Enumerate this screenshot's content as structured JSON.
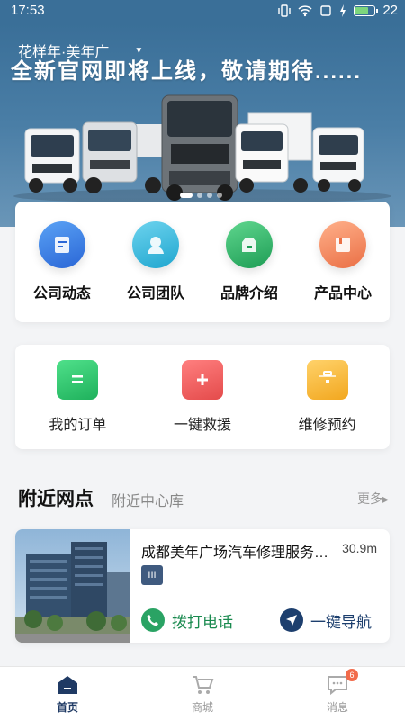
{
  "status": {
    "time": "17:53",
    "battery": "22",
    "battery_fraction": 0.6
  },
  "hero": {
    "location": "花样年·美年广",
    "slogan": "全新官网即将上线，敬请期待......",
    "slide_count": 4,
    "active_slide": 0
  },
  "shortcuts": [
    {
      "label": "公司动态",
      "icon": "news-icon",
      "color": "#3b7be0"
    },
    {
      "label": "公司团队",
      "icon": "team-icon",
      "color": "#2bb5d8"
    },
    {
      "label": "品牌介绍",
      "icon": "brand-icon",
      "color": "#27ae60"
    },
    {
      "label": "产品中心",
      "icon": "product-icon",
      "color": "#f08a5d"
    }
  ],
  "services": [
    {
      "label": "我的订单",
      "icon": "order-icon",
      "color": "#2ec46e"
    },
    {
      "label": "一键救援",
      "icon": "rescue-icon",
      "color": "#ee5a5a"
    },
    {
      "label": "维修预约",
      "icon": "repair-toolbox-icon",
      "color": "#f5b52e"
    }
  ],
  "nearby": {
    "title": "附近网点",
    "subtitle": "附近中心库",
    "more": "更多▸",
    "station": {
      "name": "成都美年广场汽车修理服务中心",
      "distance": "30.9m",
      "badge": "III",
      "call_label": "拨打电话",
      "nav_label": "一键导航"
    }
  },
  "tabbar": {
    "items": [
      {
        "label": "首页",
        "icon": "home-icon",
        "active": true
      },
      {
        "label": "商城",
        "icon": "cart-icon",
        "active": false
      },
      {
        "label": "消息",
        "icon": "message-icon",
        "active": false,
        "badge": "6"
      }
    ]
  },
  "colors": {
    "header_blue": "#3a6f98",
    "tab_active": "#1f3a64",
    "call_green": "#1a8a4f",
    "nav_navy": "#1d3f6e"
  }
}
